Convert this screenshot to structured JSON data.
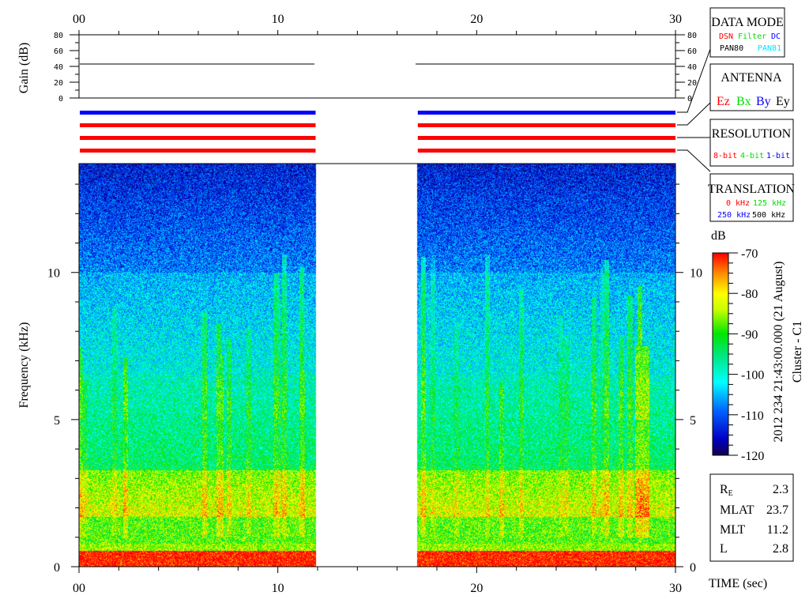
{
  "chart_data": {
    "type": "heatmap",
    "title": "Cluster - C1",
    "timestamp": "2012 234 21:43:00.000 (21 August)",
    "xlabel": "TIME (sec)",
    "ylabel": "Frequency (kHz)",
    "xlim": [
      0,
      30
    ],
    "ylim": [
      0,
      13.7
    ],
    "x_ticks": [
      "00",
      "10",
      "20",
      "30"
    ],
    "y_ticks": [
      "0",
      "5",
      "10"
    ],
    "data_segments_sec": [
      [
        0,
        11.9
      ],
      [
        17,
        30
      ]
    ],
    "colorbar": {
      "label": "dB",
      "range": [
        -120,
        -70
      ],
      "ticks": [
        "-70",
        "-80",
        "-90",
        "-100",
        "-110",
        "-120"
      ]
    },
    "gain": {
      "ylabel": "Gain (dB)",
      "ylim": [
        0,
        80
      ],
      "ticks": [
        "0",
        "20",
        "40",
        "60",
        "80"
      ],
      "value_db": 44
    },
    "status_bars": [
      {
        "name": "data-mode",
        "color": "#0000ff"
      },
      {
        "name": "antenna",
        "color": "#ff0000"
      },
      {
        "name": "resolution",
        "color": "#ff0000"
      },
      {
        "name": "translation",
        "color": "#ff0000"
      }
    ],
    "features": [
      {
        "name": "strong low-frequency band",
        "freq_khz": [
          0,
          0.6
        ],
        "db": -70
      },
      {
        "name": "band",
        "freq_khz": [
          1.0,
          3.5
        ],
        "db": -82
      },
      {
        "name": "band",
        "freq_khz": [
          3.5,
          6.5
        ],
        "db": -95
      },
      {
        "name": "background",
        "freq_khz": [
          6.5,
          10
        ],
        "db": -103
      },
      {
        "name": "background",
        "freq_khz": [
          10,
          13.7
        ],
        "db": -113
      }
    ]
  },
  "legend": {
    "data_mode": {
      "title": "DATA MODE",
      "items": [
        {
          "t": "DSN",
          "c": "#ff0000"
        },
        {
          "t": "Filter",
          "c": "#00dd00"
        },
        {
          "t": "DC",
          "c": "#0000ff"
        },
        {
          "t": "PAN80",
          "c": "#000000"
        },
        {
          "t": "PAN81",
          "c": "#00e5ff"
        }
      ]
    },
    "antenna": {
      "title": "ANTENNA",
      "items": [
        {
          "t": "Ez",
          "c": "#ff0000"
        },
        {
          "t": "Bx",
          "c": "#00dd00"
        },
        {
          "t": "By",
          "c": "#0000ff"
        },
        {
          "t": "Ey",
          "c": "#000000"
        }
      ]
    },
    "resolution": {
      "title": "RESOLUTION",
      "items": [
        {
          "t": "8-bit",
          "c": "#ff0000"
        },
        {
          "t": "4-bit",
          "c": "#00dd00"
        },
        {
          "t": "1-bit",
          "c": "#0000ff"
        }
      ]
    },
    "translation": {
      "title": "TRANSLATION",
      "items": [
        {
          "t": "0 kHz",
          "c": "#ff0000"
        },
        {
          "t": "125 kHz",
          "c": "#00dd00"
        },
        {
          "t": "250 kHz",
          "c": "#0000ff"
        },
        {
          "t": "500 kHz",
          "c": "#000000"
        }
      ]
    }
  },
  "orbit": {
    "re_label": "R",
    "re_sub": "E",
    "re_value": "2.3",
    "mlat_label": "MLAT",
    "mlat_value": "23.7",
    "mlt_label": "MLT",
    "mlt_value": "11.2",
    "l_label": "L",
    "l_value": "2.8"
  }
}
